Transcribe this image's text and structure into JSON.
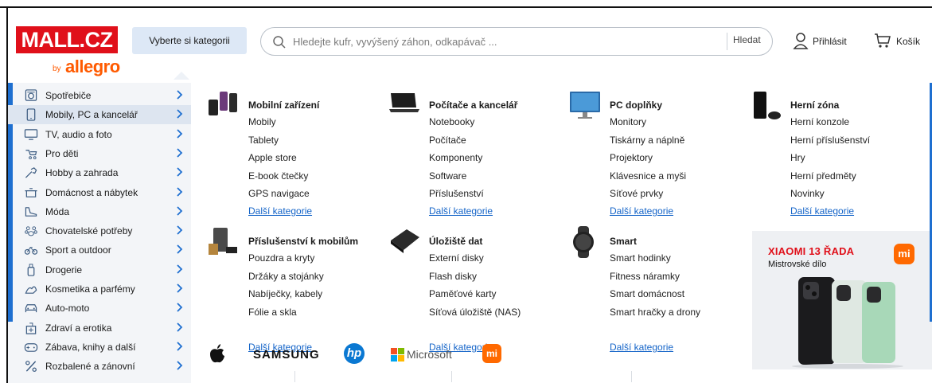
{
  "header": {
    "logo_main": "MALL.CZ",
    "logo_by": "by",
    "logo_allegro": "allegro",
    "category_button": "Vyberte si kategorii",
    "search_placeholder": "Hledejte kufr, vyvýšený záhon, odkapávač ...",
    "search_button": "Hledat",
    "login_label": "Přihlásit",
    "cart_label": "Košík"
  },
  "sidebar": {
    "items": [
      {
        "label": "Spotřebiče",
        "icon": "appliance-icon"
      },
      {
        "label": "Mobily, PC a kancelář",
        "icon": "mobile-icon"
      },
      {
        "label": "TV, audio a foto",
        "icon": "tv-icon"
      },
      {
        "label": "Pro děti",
        "icon": "stroller-icon"
      },
      {
        "label": "Hobby a zahrada",
        "icon": "tools-icon"
      },
      {
        "label": "Domácnost a nábytek",
        "icon": "pot-icon"
      },
      {
        "label": "Móda",
        "icon": "shoe-icon"
      },
      {
        "label": "Chovatelské potřeby",
        "icon": "paw-icon"
      },
      {
        "label": "Sport a outdoor",
        "icon": "bike-icon"
      },
      {
        "label": "Drogerie",
        "icon": "bottle-icon"
      },
      {
        "label": "Kosmetika a parfémy",
        "icon": "cosmetics-icon"
      },
      {
        "label": "Auto-moto",
        "icon": "car-icon"
      },
      {
        "label": "Zdraví a erotika",
        "icon": "health-icon"
      },
      {
        "label": "Zábava, knihy a další",
        "icon": "gamepad-icon"
      },
      {
        "label": "Rozbalené a zánovní",
        "icon": "percent-icon"
      }
    ],
    "active_index": 1
  },
  "menu": {
    "groups": [
      {
        "title": "Mobilní zařízení",
        "links": [
          "Mobily",
          "Tablety",
          "Apple store",
          "E-book čtečky",
          "GPS navigace"
        ],
        "more": "Další kategorie"
      },
      {
        "title": "Počítače a kancelář",
        "links": [
          "Notebooky",
          "Počítače",
          "Komponenty",
          "Software",
          "Příslušenství"
        ],
        "more": "Další kategorie"
      },
      {
        "title": "PC doplňky",
        "links": [
          "Monitory",
          "Tiskárny a náplně",
          "Projektory",
          "Klávesnice a myši",
          "Síťové prvky"
        ],
        "more": "Další kategorie"
      },
      {
        "title": "Herní zóna",
        "links": [
          "Herní konzole",
          "Herní příslušenství",
          "Hry",
          "Herní předměty",
          "Novinky"
        ],
        "more": "Další kategorie"
      },
      {
        "title": "Příslušenství k mobilům",
        "links": [
          "Pouzdra a kryty",
          "Držáky a stojánky",
          "Nabíječky, kabely",
          "Fólie a skla"
        ],
        "more": "Další kategorie"
      },
      {
        "title": "Úložiště dat",
        "links": [
          "Externí disky",
          "Flash disky",
          "Paměťové karty",
          "Síťová úložiště (NAS)"
        ],
        "more": "Další kategorie"
      },
      {
        "title": "Smart",
        "links": [
          "Smart hodinky",
          "Fitness náramky",
          "Smart domácnost",
          "Smart hračky a drony"
        ],
        "more": "Další kategorie"
      }
    ],
    "brands": {
      "samsung": "SAMSUNG",
      "hp": "hp",
      "microsoft": "Microsoft",
      "xiaomi": "mi"
    }
  },
  "promo": {
    "title": "XIAOMI 13 ŘADA",
    "subtitle": "Mistrovské dílo",
    "logo": "mi"
  },
  "colors": {
    "brand_red": "#e0101a",
    "allegro_orange": "#ff5a00",
    "link_blue": "#1464c8",
    "accent_blue": "#1e6fd0"
  }
}
